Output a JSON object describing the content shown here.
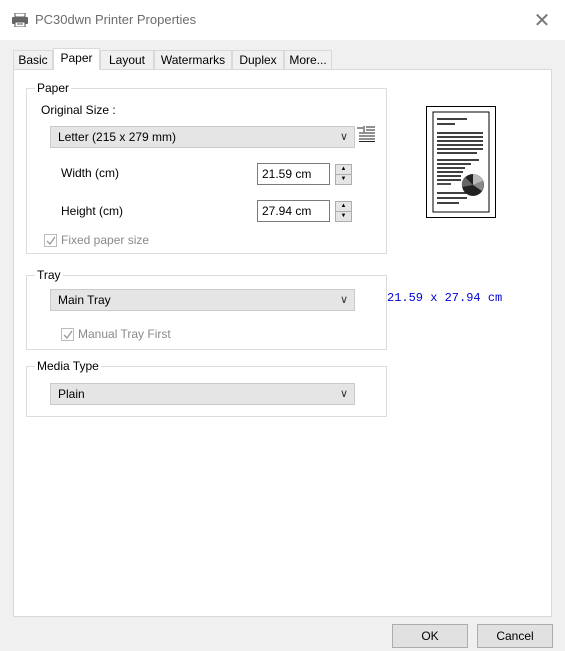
{
  "window": {
    "title": "PC30dwn Printer Properties",
    "close_glyph": "✕"
  },
  "tabs": [
    {
      "label": "Basic",
      "active": false
    },
    {
      "label": "Paper",
      "active": true
    },
    {
      "label": "Layout",
      "active": false
    },
    {
      "label": "Watermarks",
      "active": false
    },
    {
      "label": "Duplex",
      "active": false
    },
    {
      "label": "More...",
      "active": false
    }
  ],
  "paper": {
    "legend": "Paper",
    "original_size_label": "Original Size :",
    "original_size_value": "Letter (215 x 279 mm)",
    "width_label": "Width (cm)",
    "width_value": "21.59 cm",
    "height_label": "Height (cm)",
    "height_value": "27.94 cm",
    "fixed_size_label": "Fixed paper size",
    "fixed_size_checked": true
  },
  "tray": {
    "legend": "Tray",
    "value": "Main Tray",
    "manual_first_label": "Manual Tray First",
    "manual_first_checked": true
  },
  "media": {
    "legend": "Media Type",
    "value": "Plain"
  },
  "preview": {
    "size_readout": "21.59 x 27.94 cm"
  },
  "buttons": {
    "ok": "OK",
    "cancel": "Cancel"
  },
  "icons": {
    "title": "printer-icon",
    "layout": "page-layout-icon",
    "combo": "chevron-down-icon",
    "spin_up": "spin-up-icon",
    "spin_down": "spin-down-icon"
  },
  "colors": {
    "readout": "#0000d0",
    "panel_bg": "#ffffff",
    "window_bg": "#f0f0f0"
  }
}
